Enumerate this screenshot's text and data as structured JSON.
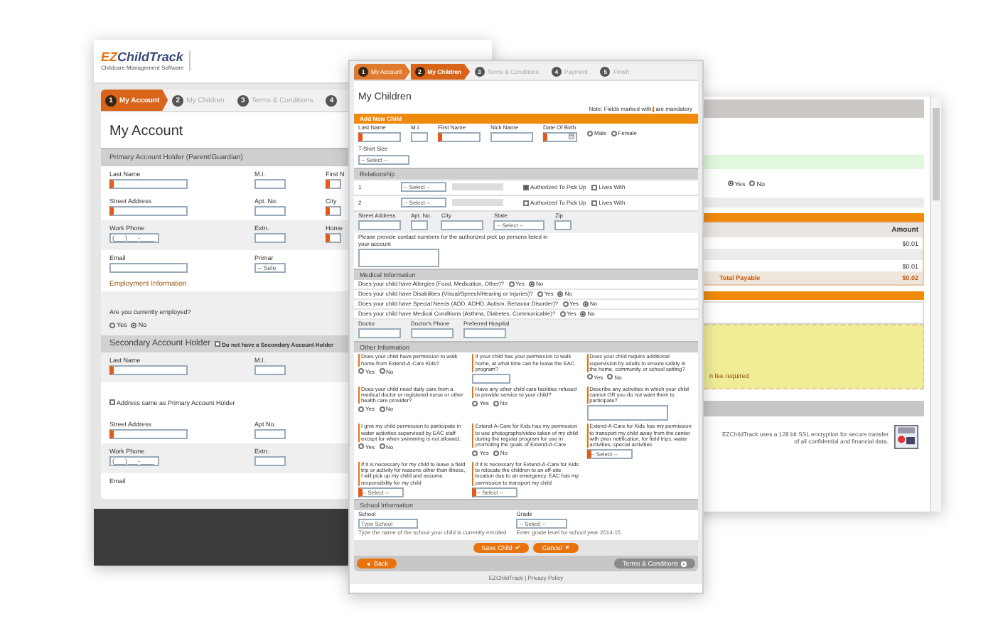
{
  "left_window": {
    "logo": {
      "mark": "EZ",
      "name": "ChildTrack",
      "tagline": "Childcare Management Software"
    },
    "steps": [
      {
        "number": "1",
        "label": "My Account",
        "selected": true
      },
      {
        "number": "2",
        "label": "My Children",
        "selected": false
      },
      {
        "number": "3",
        "label": "Terms & Conditions",
        "selected": false
      },
      {
        "number": "4",
        "selected": false
      }
    ],
    "title": "My Account",
    "blocks": [
      {
        "kind": "section",
        "label": "Primary Account Holder (Parent/Guardian)"
      },
      {
        "kind": "fields",
        "shaded": false,
        "fields": [
          {
            "label": "Last Name",
            "kind": "wide",
            "required": true
          },
          {
            "label": "M.I.",
            "kind": "short",
            "required": false
          },
          {
            "label": "First N",
            "kind": "short",
            "required": true
          }
        ]
      },
      {
        "kind": "fields",
        "shaded": false,
        "fields": [
          {
            "label": "Street Address",
            "kind": "wide",
            "required": true
          },
          {
            "label": "Apt. No.",
            "kind": "short",
            "required": false
          },
          {
            "label": "City",
            "kind": "short",
            "required": true
          }
        ]
      },
      {
        "kind": "fields",
        "shaded": true,
        "fields": [
          {
            "label": "Work Phone",
            "kind": "medium",
            "required": false,
            "value": "(___)___-____"
          },
          {
            "label": "Extn.",
            "kind": "short",
            "required": false
          },
          {
            "label": "Home",
            "kind": "short",
            "required": true
          }
        ]
      },
      {
        "kind": "fields",
        "shaded": false,
        "fields": [
          {
            "label": "Email",
            "kind": "wide",
            "required": false
          },
          {
            "label": "Primar",
            "kind": "select",
            "required": false,
            "value": "-- Sele"
          }
        ]
      },
      {
        "kind": "subheading",
        "label": "Employment Information"
      },
      {
        "kind": "question",
        "shaded": true,
        "label": "Are you currently employed?",
        "options": [
          {
            "label": "Yes",
            "selected": false
          },
          {
            "label": "No",
            "selected": true
          }
        ]
      },
      {
        "kind": "big_section",
        "label": "Secondary Account Holder",
        "checkbox": {
          "label": "Do not have a Secondary Account Holder",
          "checked": false
        }
      },
      {
        "kind": "fields",
        "shaded": true,
        "fields": [
          {
            "label": "Last Name",
            "kind": "wide",
            "required": true
          },
          {
            "label": "M.I.",
            "kind": "short",
            "required": false
          }
        ]
      },
      {
        "kind": "checkbox",
        "label": "Address same as Primary Account Holder",
        "checked": false
      },
      {
        "kind": "fields",
        "shaded": false,
        "fields": [
          {
            "label": "Street Address",
            "kind": "wide",
            "required": true
          },
          {
            "label": "Apt No.",
            "kind": "short",
            "required": false
          }
        ]
      },
      {
        "kind": "fields",
        "shaded": true,
        "fields": [
          {
            "label": "Work Phone",
            "kind": "medium",
            "required": false,
            "value": "(___)___-____"
          },
          {
            "label": "Extn.",
            "kind": "short",
            "required": false
          }
        ]
      },
      {
        "kind": "fields",
        "shaded": false,
        "fields": [
          {
            "label": "Email",
            "kind": "label_only"
          }
        ]
      }
    ]
  },
  "middle_window": {
    "steps": [
      {
        "number": "1",
        "label": "My Account",
        "selected": false,
        "completed": true
      },
      {
        "number": "2",
        "label": "My Children",
        "selected": true,
        "completed": false
      },
      {
        "number": "3",
        "label": "Terms & Conditions",
        "selected": false,
        "completed": false
      },
      {
        "number": "4",
        "label": "Payment",
        "selected": false,
        "completed": false
      },
      {
        "number": "5",
        "label": "Finish",
        "selected": false,
        "completed": false
      }
    ],
    "title": "My Children",
    "note": {
      "before": "Note: Fields marked with",
      "after": "are mandatory"
    },
    "blocks": [
      {
        "kind": "orange_bar",
        "label": "Add New Child"
      },
      {
        "kind": "fields",
        "shaded": false,
        "fields": [
          {
            "label": "Last Name",
            "kind": "wide",
            "required": true
          },
          {
            "label": "M.I.",
            "kind": "short",
            "required": false
          },
          {
            "label": "First Name",
            "kind": "wide",
            "required": true
          },
          {
            "label": "Nick Name",
            "kind": "wide",
            "required": false
          },
          {
            "label": "Date Of Birth",
            "kind": "date",
            "required": true
          },
          {
            "kind": "radios",
            "options": [
              {
                "label": "Male",
                "selected": false
              },
              {
                "label": "Female",
                "selected": false
              }
            ]
          }
        ]
      },
      {
        "kind": "fields",
        "shaded": false,
        "fields": [
          {
            "label": "T-Shirt Size",
            "kind": "select",
            "required": false,
            "value": "-- Select --"
          }
        ]
      },
      {
        "kind": "section",
        "label": "Relationship"
      },
      {
        "kind": "relations",
        "rows": [
          {
            "number": "1",
            "select": "-- Select --",
            "authorized": {
              "label": "Authorized To Pick Up",
              "checked": true
            },
            "lives_with": {
              "label": "Lives With",
              "checked": false
            }
          },
          {
            "number": "2",
            "select": "-- Select --",
            "authorized": {
              "label": "Authorized To Pick Up",
              "checked": false
            },
            "lives_with": {
              "label": "Lives With",
              "checked": false
            }
          }
        ]
      },
      {
        "kind": "fields",
        "shaded": true,
        "fields": [
          {
            "label": "Street Address",
            "kind": "wide",
            "required": false
          },
          {
            "label": "Apt. No.",
            "kind": "short",
            "required": false
          },
          {
            "label": "City",
            "kind": "wide",
            "required": false
          },
          {
            "label": "State",
            "kind": "select",
            "required": false,
            "value": "-- Select --"
          },
          {
            "label": "Zip",
            "kind": "short",
            "required": false
          }
        ]
      },
      {
        "kind": "textarea",
        "label": "Please provide contact numbers for the authorized pick up persons listed in your account"
      },
      {
        "kind": "section",
        "label": "Medical Information"
      },
      {
        "kind": "question",
        "shaded": false,
        "label": "Does your child have Allergies (Food, Medication, Other)?",
        "options": [
          {
            "label": "Yes",
            "selected": false
          },
          {
            "label": "No",
            "selected": true
          }
        ]
      },
      {
        "kind": "question",
        "shaded": false,
        "label": "Does your child have Disabilities (Visual/Speech/Hearing or Injuries)?",
        "options": [
          {
            "label": "Yes",
            "selected": false
          },
          {
            "label": "No",
            "selected": true
          }
        ]
      },
      {
        "kind": "question",
        "shaded": false,
        "label": "Does your child have Special Needs (ADD, ADHD, Autism, Behavior Disorder)?",
        "options": [
          {
            "label": "Yes",
            "selected": false
          },
          {
            "label": "No",
            "selected": true
          }
        ]
      },
      {
        "kind": "question",
        "shaded": false,
        "label": "Does your child have Medical Conditions (Asthma, Diabetes, Communicable)?",
        "options": [
          {
            "label": "Yes",
            "selected": false
          },
          {
            "label": "No",
            "selected": true
          }
        ]
      },
      {
        "kind": "fields",
        "shaded": true,
        "fields": [
          {
            "label": "Doctor",
            "kind": "wide",
            "required": false
          },
          {
            "label": "Doctor's Phone",
            "kind": "wide",
            "required": false
          },
          {
            "label": "Preferred Hospital",
            "kind": "wide",
            "required": false
          }
        ]
      },
      {
        "kind": "section",
        "label": "Other Information"
      },
      {
        "kind": "grid_questions",
        "items": [
          {
            "label": "Does your child have permission to walk home from Extend-A-Care Kids?",
            "kind": "radios",
            "options": [
              {
                "label": "Yes",
                "selected": false
              },
              {
                "label": "No",
                "selected": false
              }
            ]
          },
          {
            "label": "If your child has your permission to walk home, at what time can he leave the EAC program?",
            "kind": "text"
          },
          {
            "label": "Does your child require additional supervision by adults to ensure safety in the home, community or school setting?",
            "kind": "radios",
            "options": [
              {
                "label": "Yes",
                "selected": false
              },
              {
                "label": "No",
                "selected": false
              }
            ]
          },
          {
            "label": "Does your child need daily care from a medical doctor or registered nurse or other health care provider?",
            "kind": "radios",
            "options": [
              {
                "label": "Yes",
                "selected": false
              },
              {
                "label": "No",
                "selected": false
              }
            ]
          },
          {
            "label": "Have any other child care facilities refused to provide service to your child?",
            "kind": "radios",
            "options": [
              {
                "label": "Yes",
                "selected": false
              },
              {
                "label": "No",
                "selected": false
              }
            ]
          },
          {
            "label": "Describe any activities in which your child cannot OR you do not want them to participate?",
            "kind": "textarea"
          },
          {
            "label": "I give my child permission to participate in water activities supervised by EAC staff except for when swimming is not allowed.",
            "kind": "radios",
            "options": [
              {
                "label": "Yes",
                "selected": false
              },
              {
                "label": "No",
                "selected": false
              }
            ]
          },
          {
            "label": "Extend-A-Care for Kids has my permission to use photographs/video taken of my child during the regular program for use in promoting the goals of Extend-A-Care",
            "kind": "radios",
            "options": [
              {
                "label": "Yes",
                "selected": false
              },
              {
                "label": "No",
                "selected": false
              }
            ]
          },
          {
            "label": "Extend-A-Care for Kids has my permission to transport my child away from the center with prior notification, for field trips, water activities, special activities",
            "kind": "select",
            "value": "-- Select --"
          },
          {
            "label": "If it is necessary for my child to leave a field trip or activity for reasons other than illness, I will pick up my child and assume responsibility for my child",
            "kind": "select",
            "value": "-- Select --"
          },
          {
            "label": "If it is necessary for Extend-A-Care for Kids to relocate the children to an off-site location due to an emergency, EAC has my permission to transport my child",
            "kind": "select",
            "value": "-- Select --"
          }
        ]
      },
      {
        "kind": "section",
        "label": "School Information"
      },
      {
        "kind": "fields",
        "shaded": false,
        "fields": [
          {
            "label": "School",
            "kind": "wide",
            "required": false,
            "placeholder": "Type School",
            "hint": "Type the name of the school your child is currently enrolled"
          },
          {
            "label": "Grade",
            "kind": "select",
            "required": false,
            "value": "-- Select --",
            "hint": "Enter grade level for school year 2014-15"
          }
        ]
      },
      {
        "kind": "buttons",
        "buttons": [
          "Save Child",
          "Cancel"
        ]
      }
    ],
    "nav": {
      "back": "Back",
      "next": "Terms & Conditions"
    },
    "footer": "EZChildTrack | Privacy Policy"
  },
  "right_window": {
    "options": [
      {
        "label": "Yes",
        "selected": true
      },
      {
        "label": "No",
        "selected": false
      }
    ],
    "table": {
      "column": "Amount",
      "rows": [
        {
          "amount": "$0.01"
        },
        {},
        {
          "amount": "$0.01"
        }
      ],
      "total_label": "Total Payable",
      "total": "$0.02"
    },
    "notice": "n fee required",
    "footer": "EZChildTrack uses a 128 bit SSL encryption for secure transfer of all confidential and financial data."
  }
}
